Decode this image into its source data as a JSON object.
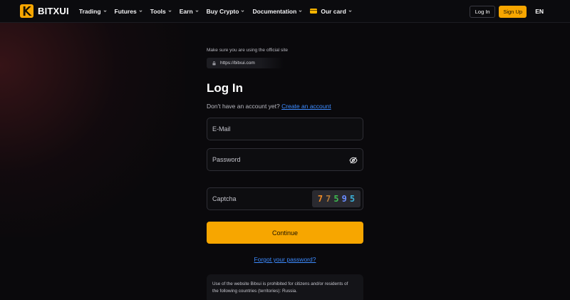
{
  "header": {
    "brand": "BITXUI",
    "nav": [
      {
        "label": "Trading",
        "icon": "chevron-down-icon"
      },
      {
        "label": "Futures",
        "icon": "chevron-down-icon"
      },
      {
        "label": "Tools",
        "icon": "chevron-down-icon"
      },
      {
        "label": "Earn",
        "icon": "chevron-down-icon"
      },
      {
        "label": "Buy Crypto",
        "icon": "chevron-down-icon"
      },
      {
        "label": "Documentation",
        "icon": "chevron-down-icon"
      },
      {
        "label": "Our card",
        "icon": "card-icon"
      }
    ],
    "login_label": "Log In",
    "signup_label": "Sign Up",
    "language": "EN"
  },
  "login": {
    "official_note": "Make sure you are using the official site",
    "official_url": "https://bitxui.com",
    "title": "Log In",
    "no_account_text": "Don't have an account yet?",
    "create_account_link": "Create an account",
    "email_placeholder": "E-Mail",
    "password_placeholder": "Password",
    "captcha_placeholder": "Captcha",
    "captcha_digits": [
      {
        "char": "7",
        "color": "#f08a24"
      },
      {
        "char": "7",
        "color": "#b0793a"
      },
      {
        "char": "5",
        "color": "#3fb950"
      },
      {
        "char": "9",
        "color": "#6a8cff"
      },
      {
        "char": "5",
        "color": "#3ab0d8"
      }
    ],
    "continue_label": "Continue",
    "forgot_link": "Forgot your password?",
    "notice_line1": "Use of the website Bitxui is prohibited for citizens and/or residents of",
    "notice_line2": "the following countries (territories): Russia."
  },
  "colors": {
    "accent": "#f7a600",
    "link": "#3d8bff",
    "background": "#0a090c"
  }
}
